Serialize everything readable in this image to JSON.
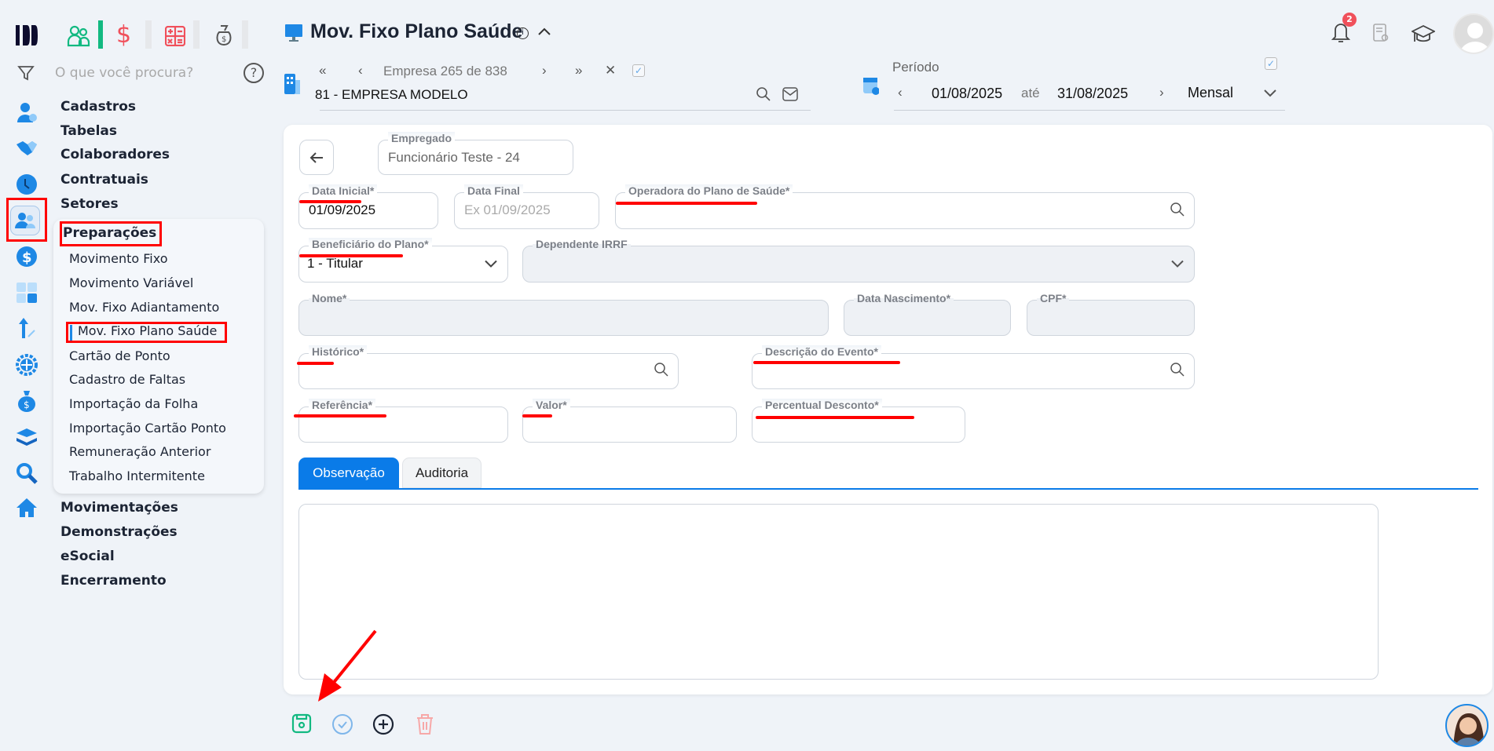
{
  "topbar": {
    "search_placeholder": "O que você procura?"
  },
  "menu": {
    "sections": [
      "Cadastros",
      "Tabelas",
      "Colaboradores",
      "Contratuais",
      "Setores"
    ],
    "active_section": "Preparações",
    "sub_items": [
      "Movimento Fixo",
      "Movimento Variável",
      "Mov. Fixo Adiantamento",
      "Mov. Fixo Plano Saúde",
      "Cartão de Ponto",
      "Cadastro de Faltas",
      "Importação da Folha",
      "Importação Cartão Ponto",
      "Remuneração Anterior",
      "Trabalho Intermitente"
    ],
    "sections_after": [
      "Movimentações",
      "Demonstrações",
      "eSocial",
      "Encerramento"
    ]
  },
  "header": {
    "title": "Mov. Fixo Plano Saúde",
    "notification_count": "2"
  },
  "company": {
    "nav_label": "Empresa 265 de 838",
    "name": "81 - EMPRESA MODELO"
  },
  "period": {
    "label": "Período",
    "start": "01/08/2025",
    "until": "até",
    "end": "31/08/2025",
    "frequency": "Mensal"
  },
  "form": {
    "employee_label": "Empregado",
    "employee_value": "Funcionário Teste - 24",
    "data_inicial_label": "Data Inicial*",
    "data_inicial_value": "01/09/2025",
    "data_final_label": "Data Final",
    "data_final_placeholder": "Ex 01/09/2025",
    "operadora_label": "Operadora do Plano de Saúde*",
    "beneficiario_label": "Beneficiário do Plano*",
    "beneficiario_value": "1 - Titular",
    "dependente_label": "Dependente IRRF",
    "nome_label": "Nome*",
    "nascimento_label": "Data Nascimento*",
    "cpf_label": "CPF*",
    "historico_label": "Histórico*",
    "descricao_label": "Descrição do Evento*",
    "referencia_label": "Referência*",
    "valor_label": "Valor*",
    "percentual_label": "Percentual Desconto*"
  },
  "tabs": [
    "Observação",
    "Auditoria"
  ],
  "colors": {
    "accent": "#0a7be8",
    "annotation": "#ff0000",
    "save": "#12b981",
    "trash": "#f7a8a8"
  }
}
